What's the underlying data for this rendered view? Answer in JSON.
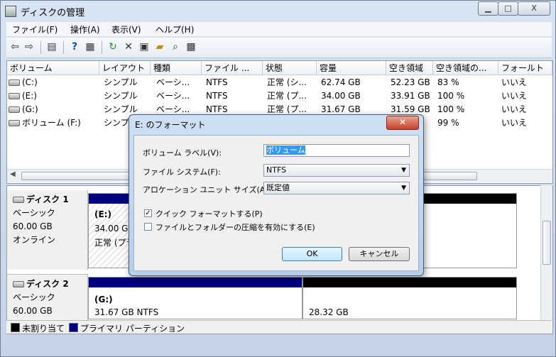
{
  "window": {
    "title": "ディスクの管理",
    "min": "▁",
    "max": "□",
    "close": "X"
  },
  "menu": [
    "ファイル(F)",
    "操作(A)",
    "表示(V)",
    "ヘルプ(H)"
  ],
  "columns": [
    "ボリューム",
    "レイアウト",
    "種類",
    "ファイル ...",
    "状態",
    "容量",
    "空き領域",
    "空き領域の...",
    "フォールト"
  ],
  "volumes": [
    {
      "name": "(C:)",
      "layout": "シンプル",
      "type": "ベーシ...",
      "fs": "NTFS",
      "status": "正常 (シ...",
      "capacity": "62.74 GB",
      "free": "52.23 GB",
      "pct": "83 %",
      "ft": "いいえ"
    },
    {
      "name": "(E:)",
      "layout": "シンプル",
      "type": "ベーシ...",
      "fs": "NTFS",
      "status": "正常 (プ...",
      "capacity": "34.00 GB",
      "free": "33.91 GB",
      "pct": "100 %",
      "ft": "いいえ"
    },
    {
      "name": "(G:)",
      "layout": "シンプル",
      "type": "ベーシ...",
      "fs": "NTFS",
      "status": "正常 (プ...",
      "capacity": "31.67 GB",
      "free": "31.59 GB",
      "pct": "100 %",
      "ft": "いいえ"
    },
    {
      "name": "ボリューム (F:)",
      "layout": "シンプ",
      "type": "",
      "fs": "",
      "status": "",
      "capacity": "",
      "free": "",
      "pct": "99 %",
      "ft": "いいえ"
    }
  ],
  "disks": [
    {
      "name": "ディスク 1",
      "kind": "ベーシック",
      "size": "60.00 GB",
      "state": "オンライン",
      "part_name": "(E:)",
      "part_size": "34.00 GB",
      "part_status": "正常 (プラ"
    },
    {
      "name": "ディスク 2",
      "kind": "ベーシック",
      "size": "60.00 GB",
      "part_name": "(G:)",
      "part_size": "31.67 GB NTFS",
      "unalloc_size": "28.32 GB"
    }
  ],
  "legend": {
    "unallocated": "未割り当て",
    "primary": "プライマリ パーティション"
  },
  "dialog": {
    "title": "E: のフォーマット",
    "label_caption": "ボリューム ラベル(V):",
    "label_value": "ボリューム",
    "fs_caption": "ファイル システム(F):",
    "fs_value": "NTFS",
    "alloc_caption": "アロケーション ユニット サイズ(A):",
    "alloc_value": "既定値",
    "quick_format": "クイック フォーマットする(P)",
    "quick_checked": true,
    "compress": "ファイルとフォルダーの圧縮を有効にする(E)",
    "compress_checked": false,
    "ok": "OK",
    "cancel": "キャンセル"
  },
  "colors": {
    "primary": "#00007f",
    "unallocated": "#000000",
    "accent": "#3399ff"
  }
}
